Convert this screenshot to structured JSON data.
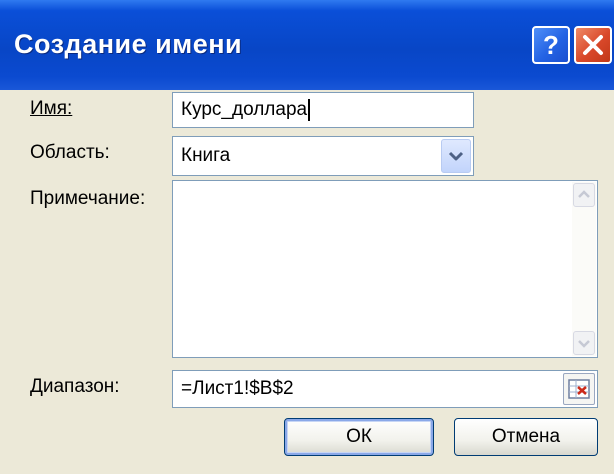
{
  "window": {
    "title": "Создание имени"
  },
  "titlebar": {
    "help_icon": "help-icon",
    "close_icon": "close-icon"
  },
  "form": {
    "name_label": "Имя:",
    "name_value": "Курс_доллара",
    "scope_label": "Область:",
    "scope_value": "Книга",
    "comment_label": "Примечание:",
    "comment_value": "",
    "range_label": "Диапазон:",
    "range_value": "=Лист1!$B$2"
  },
  "buttons": {
    "ok_label": "ОК",
    "cancel_label": "Отмена"
  },
  "colors": {
    "titlebar": "#0846c6",
    "close_button": "#d9482a",
    "dialog_face": "#ece9d8"
  }
}
